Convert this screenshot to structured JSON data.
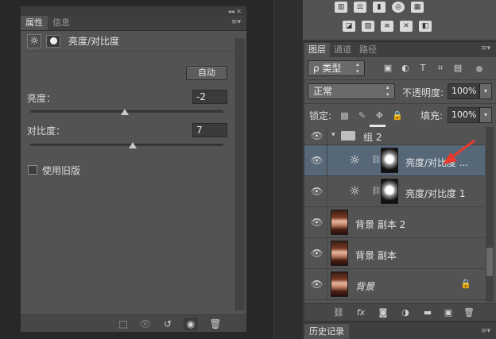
{
  "properties_panel": {
    "tabs": [
      "属性",
      "信息"
    ],
    "title": "亮度/对比度",
    "auto_button": "自动",
    "brightness": {
      "label": "亮度：",
      "value": "-2",
      "slider_fraction": 0.49
    },
    "contrast": {
      "label": "对比度：",
      "value": "7",
      "slider_fraction": 0.53
    },
    "legacy_checkbox": {
      "label": "使用旧版",
      "checked": false
    },
    "top_controls": "◂◂ ✕"
  },
  "layers_panel": {
    "tabs": [
      "图层",
      "通道",
      "路径"
    ],
    "filter_select": "ρ 类型",
    "blend_mode": "正常",
    "opacity_label": "不透明度:",
    "opacity_value": "100%",
    "lock_label": "锁定:",
    "fill_label": "填充:",
    "fill_value": "100%",
    "layers": [
      {
        "name": "组 2",
        "kind": "group"
      },
      {
        "name": "亮度/对比度 ...",
        "kind": "adjustment",
        "selected": true
      },
      {
        "name": "亮度/对比度 1",
        "kind": "adjustment"
      },
      {
        "name": "背景 副本 2",
        "kind": "image"
      },
      {
        "name": "背景 副本",
        "kind": "image"
      },
      {
        "name": "背景",
        "kind": "image",
        "locked": true
      }
    ]
  },
  "history_panel": {
    "tab": "历史记录"
  },
  "colors": {
    "accent_selected": "#566878",
    "panel_bg": "#535353",
    "arrow": "#e83a2e"
  }
}
